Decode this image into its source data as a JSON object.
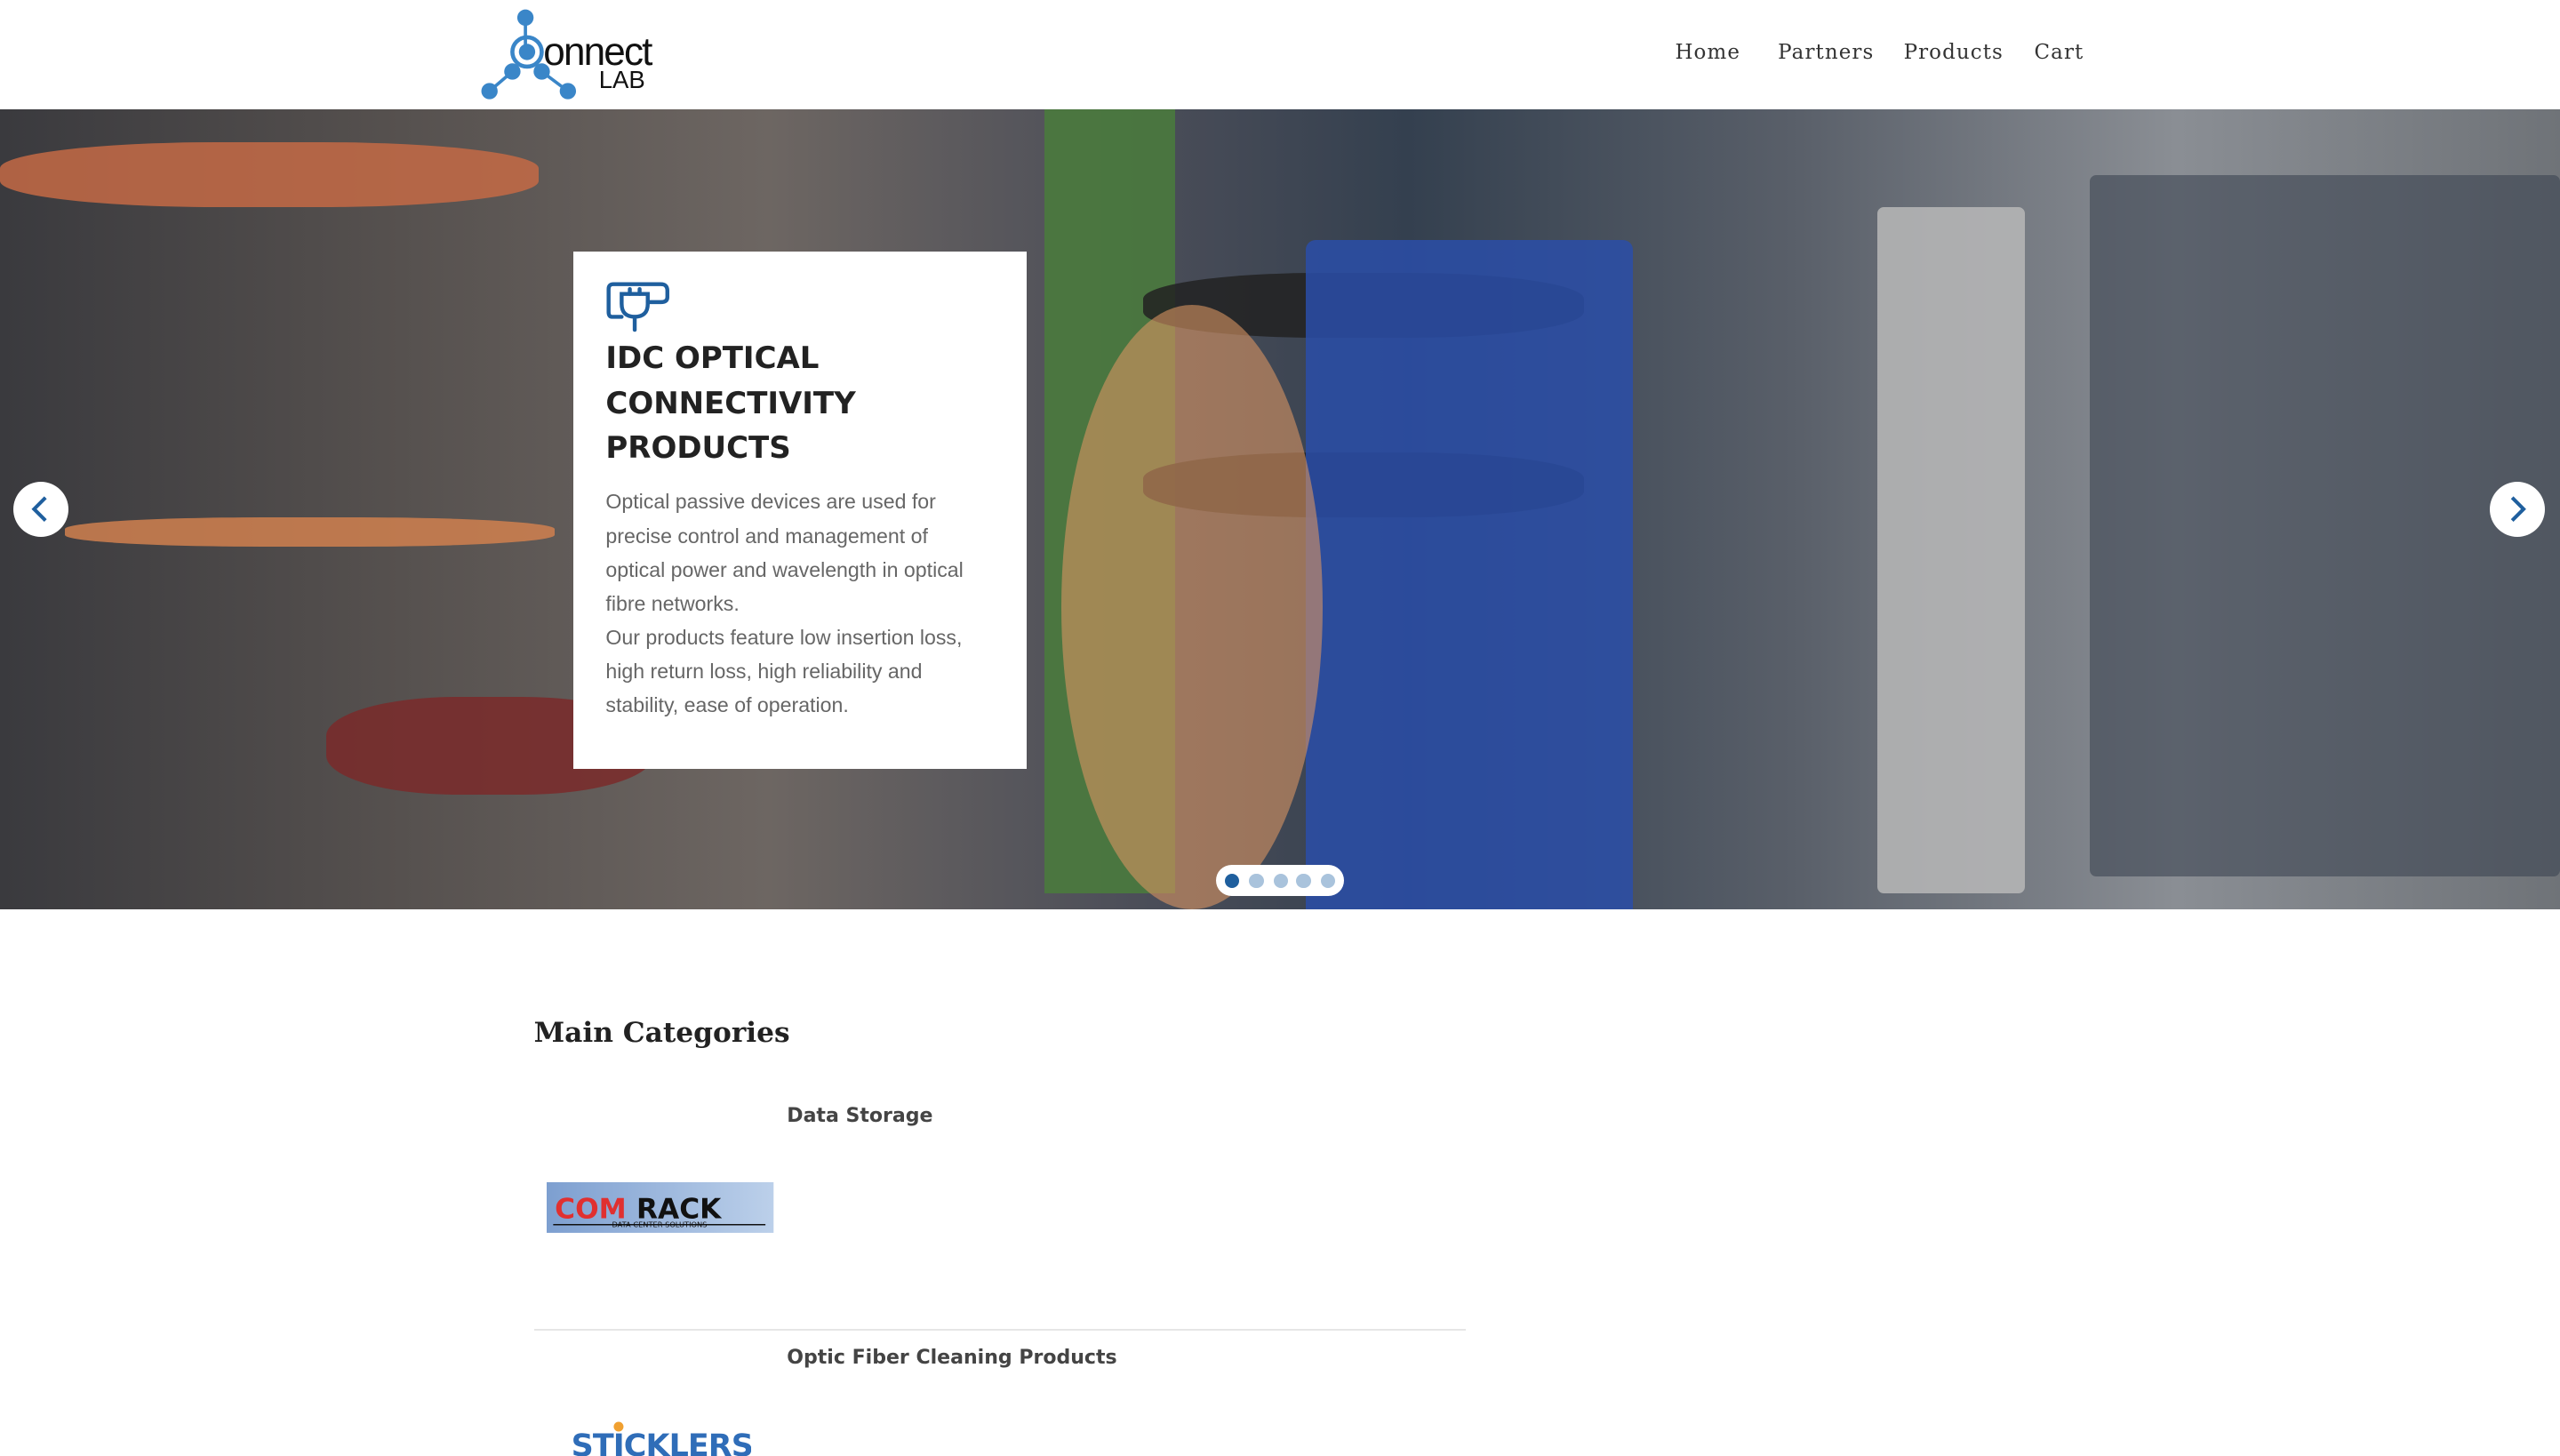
{
  "header": {
    "logo_text": "Connect LAB",
    "nav": [
      {
        "label": "Home"
      },
      {
        "label": "Partners"
      },
      {
        "label": "Products"
      },
      {
        "label": "Cart"
      }
    ]
  },
  "hero": {
    "icon": "plug-icon",
    "title": "IDC OPTICAL CONNECTIVITY PRODUCTS",
    "description": "Optical passive devices are used for precise control and management of optical power and wavelength in optical fibre networks.",
    "description2": "Our products feature low insertion loss, high return loss, high reliability and stability, ease of operation.",
    "slide_count": 5,
    "active_slide": 1,
    "accent": "#1f5f9e"
  },
  "main": {
    "heading": "Main Categories",
    "categories": [
      {
        "name": "Data Storage",
        "logo": "COMRACK",
        "logo_sub": "DATA CENTER SOLUTIONS"
      },
      {
        "name": "Optic Fiber Cleaning Products",
        "logo": "STICKLERS"
      }
    ]
  }
}
